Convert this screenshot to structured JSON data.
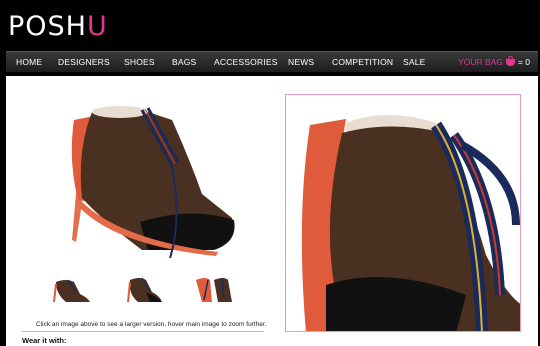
{
  "brand": {
    "logo_main": "POSH",
    "logo_accent": "U"
  },
  "nav": {
    "items": [
      "HOME",
      "DESIGNERS",
      "SHOES",
      "BAGS",
      "ACCESSORIES",
      "NEWS",
      "COMPETITION",
      "SALE"
    ],
    "bag_label": "YOUR BAG",
    "bag_count": "= 0"
  },
  "product": {
    "hint": "Click an image above to see a larger version, hover main image to zoom further.",
    "wear_heading": "Wear it with:"
  },
  "colors": {
    "accent": "#e2368f",
    "nav_bg": "#2a2a2a",
    "suede": "#4a3020",
    "leather": "#e25a3a"
  }
}
